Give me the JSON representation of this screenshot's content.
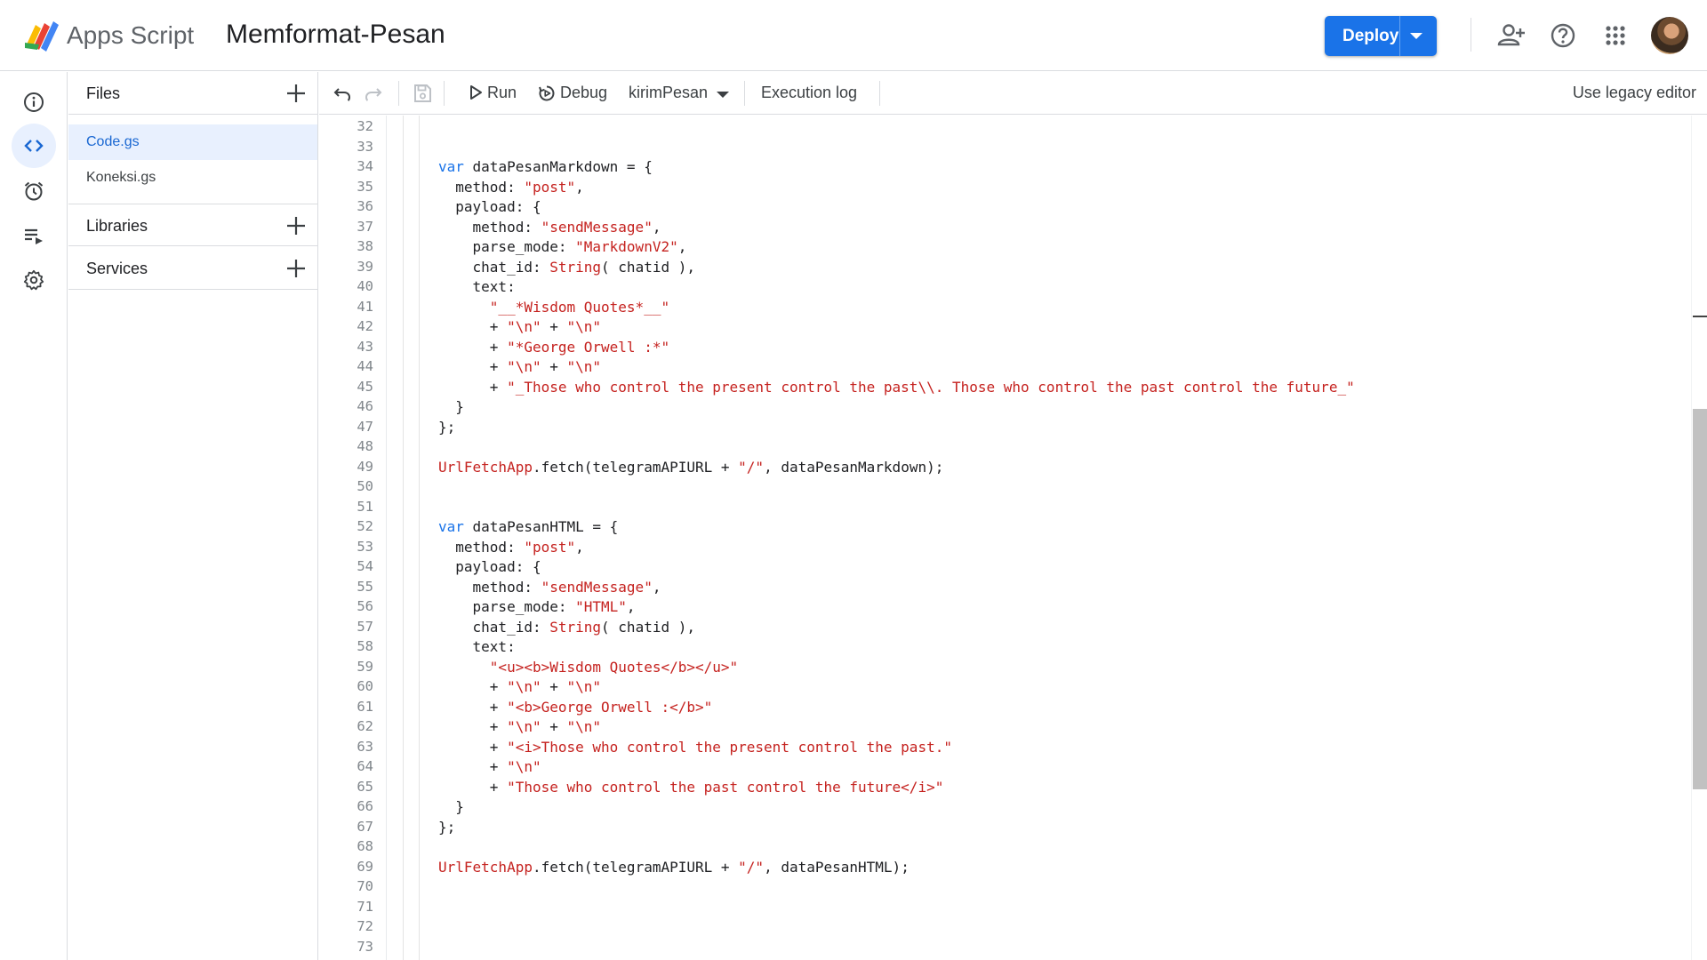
{
  "header": {
    "app_name": "Apps Script",
    "project_title": "Memformat-Pesan",
    "deploy_label": "Deploy",
    "icons": [
      "add-person-icon",
      "help-icon",
      "apps-grid-icon"
    ]
  },
  "colors": {
    "accent": "#1a73e8",
    "keyword": "#1a73e8",
    "string": "#c5221f",
    "selected_bg": "#e8f0fe"
  },
  "rail": [
    "info-icon",
    "code-icon",
    "alarm-icon",
    "executions-icon",
    "settings-icon"
  ],
  "files": {
    "title": "Files",
    "items": [
      "Code.gs",
      "Koneksi.gs"
    ],
    "selected": "Code.gs"
  },
  "libraries": {
    "title": "Libraries"
  },
  "services": {
    "title": "Services"
  },
  "toolbar": {
    "run_label": "Run",
    "debug_label": "Debug",
    "function_name": "kirimPesan",
    "execution_log_label": "Execution log",
    "legacy_label": "Use legacy editor"
  },
  "editor": {
    "line_numbers": [
      "32",
      "33",
      "34",
      "35",
      "36",
      "37",
      "38",
      "39",
      "40",
      "41",
      "42",
      "43",
      "44",
      "45",
      "46",
      "47",
      "48",
      "49",
      "50",
      "51",
      "52",
      "53",
      "54",
      "55",
      "56",
      "57",
      "58",
      "59",
      "60",
      "61",
      "62",
      "63",
      "64",
      "65",
      "66",
      "67",
      "68",
      "69",
      "70",
      "71",
      "72",
      "73"
    ],
    "lines": [
      [],
      [],
      [
        [
          "kw",
          "var"
        ],
        [
          "p",
          " dataPesanMarkdown = {"
        ]
      ],
      [
        [
          "p",
          "  method: "
        ],
        [
          "str",
          "\"post\""
        ],
        [
          "p",
          ","
        ]
      ],
      [
        [
          "p",
          "  payload: {"
        ]
      ],
      [
        [
          "p",
          "    method: "
        ],
        [
          "str",
          "\"sendMessage\""
        ],
        [
          "p",
          ","
        ]
      ],
      [
        [
          "p",
          "    parse_mode: "
        ],
        [
          "str",
          "\"MarkdownV2\""
        ],
        [
          "p",
          ","
        ]
      ],
      [
        [
          "p",
          "    chat_id: "
        ],
        [
          "cls",
          "String"
        ],
        [
          "p",
          "( chatid ),"
        ]
      ],
      [
        [
          "p",
          "    text:"
        ]
      ],
      [
        [
          "p",
          "      "
        ],
        [
          "str",
          "\"__*Wisdom Quotes*__\""
        ]
      ],
      [
        [
          "p",
          "      + "
        ],
        [
          "str",
          "\"\\n\""
        ],
        [
          "p",
          " + "
        ],
        [
          "str",
          "\"\\n\""
        ]
      ],
      [
        [
          "p",
          "      + "
        ],
        [
          "str",
          "\"*George Orwell :*\""
        ]
      ],
      [
        [
          "p",
          "      + "
        ],
        [
          "str",
          "\"\\n\""
        ],
        [
          "p",
          " + "
        ],
        [
          "str",
          "\"\\n\""
        ]
      ],
      [
        [
          "p",
          "      + "
        ],
        [
          "str",
          "\"_Those who control the present control the past\\\\. Those who control the past control the future_\""
        ]
      ],
      [
        [
          "p",
          "  }"
        ]
      ],
      [
        [
          "p",
          "};"
        ]
      ],
      [],
      [
        [
          "cls",
          "UrlFetchApp"
        ],
        [
          "p",
          ".fetch(telegramAPIURL + "
        ],
        [
          "str",
          "\"/\""
        ],
        [
          "p",
          ", dataPesanMarkdown);"
        ]
      ],
      [],
      [],
      [
        [
          "kw",
          "var"
        ],
        [
          "p",
          " dataPesanHTML = {"
        ]
      ],
      [
        [
          "p",
          "  method: "
        ],
        [
          "str",
          "\"post\""
        ],
        [
          "p",
          ","
        ]
      ],
      [
        [
          "p",
          "  payload: {"
        ]
      ],
      [
        [
          "p",
          "    method: "
        ],
        [
          "str",
          "\"sendMessage\""
        ],
        [
          "p",
          ","
        ]
      ],
      [
        [
          "p",
          "    parse_mode: "
        ],
        [
          "str",
          "\"HTML\""
        ],
        [
          "p",
          ","
        ]
      ],
      [
        [
          "p",
          "    chat_id: "
        ],
        [
          "cls",
          "String"
        ],
        [
          "p",
          "( chatid ),"
        ]
      ],
      [
        [
          "p",
          "    text:"
        ]
      ],
      [
        [
          "p",
          "      "
        ],
        [
          "str",
          "\"<u><b>Wisdom Quotes</b></u>\""
        ]
      ],
      [
        [
          "p",
          "      + "
        ],
        [
          "str",
          "\"\\n\""
        ],
        [
          "p",
          " + "
        ],
        [
          "str",
          "\"\\n\""
        ]
      ],
      [
        [
          "p",
          "      + "
        ],
        [
          "str",
          "\"<b>George Orwell :</b>\""
        ]
      ],
      [
        [
          "p",
          "      + "
        ],
        [
          "str",
          "\"\\n\""
        ],
        [
          "p",
          " + "
        ],
        [
          "str",
          "\"\\n\""
        ]
      ],
      [
        [
          "p",
          "      + "
        ],
        [
          "str",
          "\"<i>Those who control the present control the past.\""
        ]
      ],
      [
        [
          "p",
          "      + "
        ],
        [
          "str",
          "\"\\n\""
        ]
      ],
      [
        [
          "p",
          "      + "
        ],
        [
          "str",
          "\"Those who control the past control the future</i>\""
        ]
      ],
      [
        [
          "p",
          "  }"
        ]
      ],
      [
        [
          "p",
          "};"
        ]
      ],
      [],
      [
        [
          "cls",
          "UrlFetchApp"
        ],
        [
          "p",
          ".fetch(telegramAPIURL + "
        ],
        [
          "str",
          "\"/\""
        ],
        [
          "p",
          ", dataPesanHTML);"
        ]
      ],
      [],
      [],
      [],
      []
    ]
  }
}
